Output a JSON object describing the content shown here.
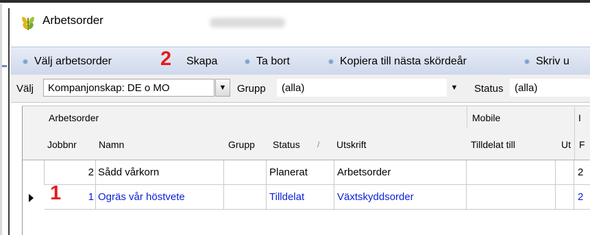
{
  "window": {
    "title": "Arbetsorder",
    "blurred_subtitle": ""
  },
  "toolbar": {
    "items": [
      "Välj arbetsorder",
      "Skapa",
      "Ta bort",
      "Kopiera till nästa skördeår",
      "Skriv u"
    ],
    "annotation": "2"
  },
  "filter": {
    "valj_label": "Välj",
    "valj_value": "Kompanjonskap: DE o MO",
    "grupp_label": "Grupp",
    "grupp_value": "(alla)",
    "status_label": "Status",
    "status_value": "(alla)"
  },
  "grid": {
    "band_arbetsorder": "Arbetsorder",
    "band_mobile": "Mobile",
    "band_right": "I",
    "headers": {
      "jobbnr": "Jobbnr",
      "namn": "Namn",
      "grupp": "Grupp",
      "status": "Status",
      "sort_indicator": "/",
      "utskrift": "Utskrift",
      "tilldelat": "Tilldelat till",
      "ut": "Ut",
      "right": "F"
    },
    "rows": [
      {
        "jobbnr": "2",
        "namn": "Sådd vårkorn",
        "grupp": "",
        "status": "Planerat",
        "utskrift": "Arbetsorder",
        "tilldelat": "",
        "ut": "",
        "right": "2"
      },
      {
        "jobbnr": "1",
        "namn": "Ogräs vår höstvete",
        "grupp": "",
        "status": "Tilldelat",
        "utskrift": "Växtskyddsorder",
        "tilldelat": "",
        "ut": "",
        "right": "2"
      }
    ],
    "row_annotation": "1"
  },
  "colors": {
    "selected_text": "#0b1fd4",
    "annotation": "#e41b1b",
    "toolbar_dot": "#7da2d8"
  },
  "icons": {
    "app_icon": "wheat-icon",
    "row_indicator": "triangle-right-icon"
  }
}
